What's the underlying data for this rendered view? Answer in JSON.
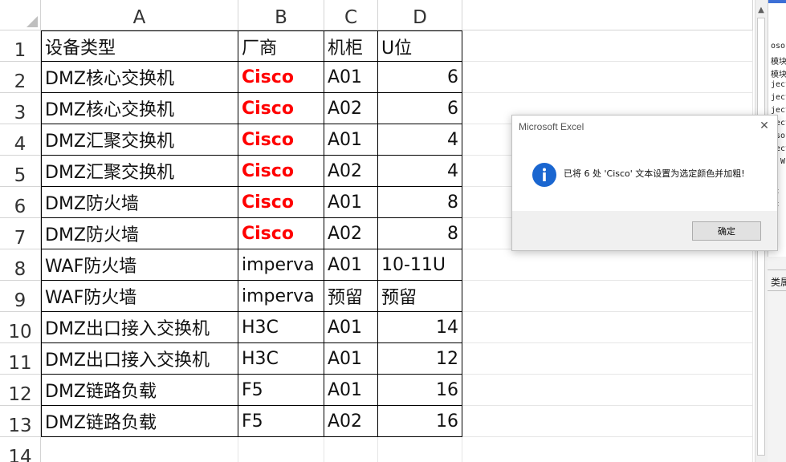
{
  "columns": [
    "A",
    "B",
    "C",
    "D"
  ],
  "rows": [
    {
      "num": "1",
      "a": "设备类型",
      "b": "厂商",
      "c": "机柜",
      "d": "U位",
      "d_num": false,
      "b_red": false
    },
    {
      "num": "2",
      "a": "DMZ核心交换机",
      "b": "Cisco",
      "c": "A01",
      "d": "6",
      "d_num": true,
      "b_red": true
    },
    {
      "num": "3",
      "a": "DMZ核心交换机",
      "b": "Cisco",
      "c": "A02",
      "d": "6",
      "d_num": true,
      "b_red": true
    },
    {
      "num": "4",
      "a": "DMZ汇聚交换机",
      "b": "Cisco",
      "c": "A01",
      "d": "4",
      "d_num": true,
      "b_red": true
    },
    {
      "num": "5",
      "a": "DMZ汇聚交换机",
      "b": "Cisco",
      "c": "A02",
      "d": "4",
      "d_num": true,
      "b_red": true
    },
    {
      "num": "6",
      "a": "DMZ防火墙",
      "b": "Cisco",
      "c": "A01",
      "d": "8",
      "d_num": true,
      "b_red": true
    },
    {
      "num": "7",
      "a": "DMZ防火墙",
      "b": "Cisco",
      "c": "A02",
      "d": "8",
      "d_num": true,
      "b_red": true
    },
    {
      "num": "8",
      "a": "WAF防火墙",
      "b": "imperva",
      "c": "A01",
      "d": "10-11U",
      "d_num": false,
      "b_red": false
    },
    {
      "num": "9",
      "a": "WAF防火墙",
      "b": "imperva",
      "c": "预留",
      "d": "预留",
      "d_num": false,
      "b_red": false
    },
    {
      "num": "10",
      "a": "DMZ出口接入交换机",
      "b": "H3C",
      "c": "A01",
      "d": "14",
      "d_num": true,
      "b_red": false
    },
    {
      "num": "11",
      "a": "DMZ出口接入交换机",
      "b": "H3C",
      "c": "A01",
      "d": "12",
      "d_num": true,
      "b_red": false
    },
    {
      "num": "12",
      "a": "DMZ链路负载",
      "b": "F5",
      "c": "A01",
      "d": "16",
      "d_num": true,
      "b_red": false
    },
    {
      "num": "13",
      "a": "DMZ链路负载",
      "b": "F5",
      "c": "A02",
      "d": "16",
      "d_num": true,
      "b_red": false
    }
  ],
  "empty_row_num": "14",
  "highlight_color": "#ff0000",
  "dialog": {
    "title": "Microsoft Excel",
    "message": "已将 6 处 'Cisco' 文本设置为选定颜色并加粗!",
    "ok_label": "确定",
    "icon": "info-icon",
    "icon_color": "#1a66d0"
  },
  "right_panel": {
    "code_lines": [
      "osof",
      "模块",
      "模块",
      "ject",
      "ject",
      "ject",
      "ject",
      "osof",
      "ject",
      "s W",
      "",
      "块",
      "块"
    ],
    "lower_text": "类属"
  }
}
